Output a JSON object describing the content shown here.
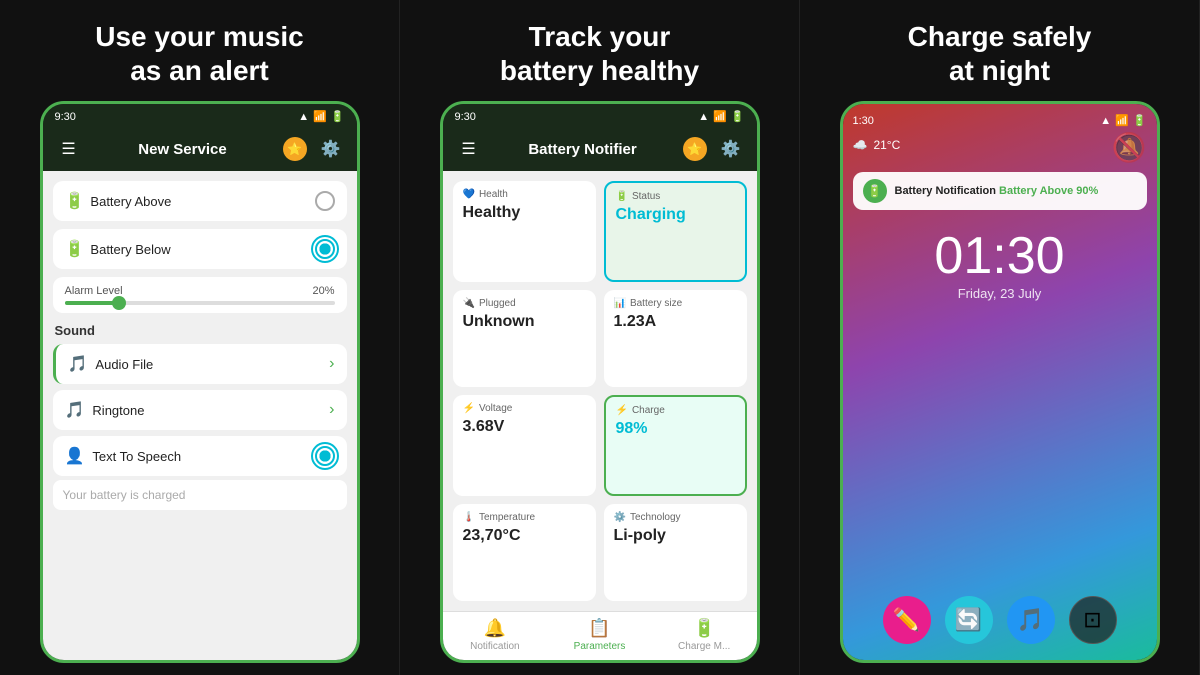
{
  "panel1": {
    "title": "Use your music\nas an alert",
    "time": "9:30",
    "appbar_title": "New Service",
    "battery_above": "Battery Above",
    "battery_below": "Battery Below",
    "alarm_level_label": "Alarm Level",
    "alarm_level_value": "20%",
    "sound_label": "Sound",
    "audio_file": "Audio File",
    "ringtone": "Ringtone",
    "text_to_speech": "Text To Speech",
    "placeholder": "Your battery is charged"
  },
  "panel2": {
    "title": "Track your\nbattery healthy",
    "time": "9:30",
    "appbar_title": "Battery Notifier",
    "health_label": "Health",
    "health_value": "Healthy",
    "status_label": "Status",
    "status_value": "Charging",
    "plugged_label": "Plugged",
    "plugged_value": "Unknown",
    "battery_size_label": "Battery size",
    "battery_size_value": "1.23A",
    "voltage_label": "Voltage",
    "voltage_value": "3.68V",
    "charge_label": "Charge",
    "charge_value": "98%",
    "temperature_label": "Temperature",
    "temperature_value": "23,70°C",
    "technology_label": "Technology",
    "technology_value": "Li-poly",
    "nav_notification": "Notification",
    "nav_parameters": "Parameters",
    "nav_charge": "Charge M..."
  },
  "panel3": {
    "title": "Charge safely\nat night",
    "time": "1:30",
    "lock_time": "01:30",
    "lock_date": "Friday, 23 July",
    "weather": "21°C",
    "notif_app": "Battery Notification",
    "notif_msg": "Battery Above 90%",
    "icons": [
      "✏️",
      "🔄",
      "🎵",
      "⊡"
    ]
  }
}
